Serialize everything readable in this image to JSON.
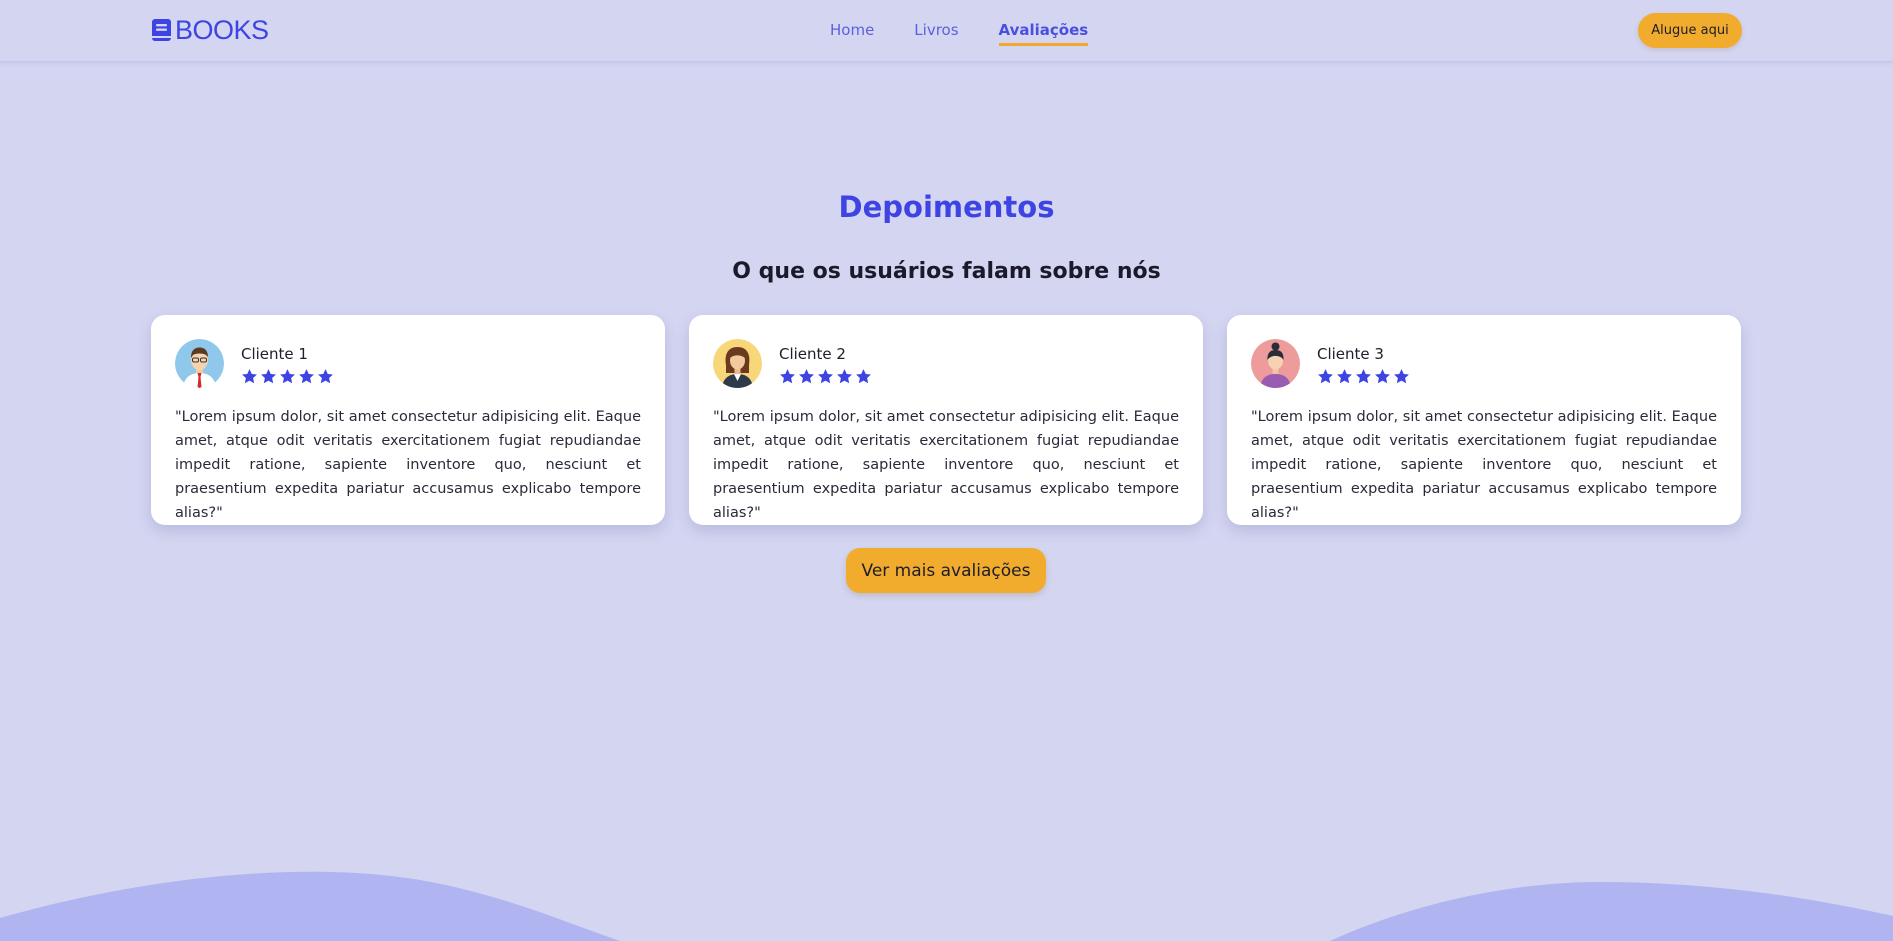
{
  "header": {
    "logo_text": "BOOKS",
    "nav": [
      {
        "label": "Home",
        "active": false
      },
      {
        "label": "Livros",
        "active": false
      },
      {
        "label": "Avaliações",
        "active": true
      }
    ],
    "cta_label": "Alugue aqui"
  },
  "section": {
    "title": "Depoimentos",
    "subtitle": "O que os usuários falam sobre nós"
  },
  "testimonials": [
    {
      "name": "Cliente 1",
      "rating": 5,
      "avatar_icon": "man-avatar-icon",
      "quote": "\"Lorem ipsum dolor, sit amet consectetur adipisicing elit. Eaque amet, atque odit veritatis exercitationem fugiat repudiandae impedit ratione, sapiente inventore quo, nesciunt et praesentium expedita pariatur accusamus explicabo tempore alias?\""
    },
    {
      "name": "Cliente 2",
      "rating": 5,
      "avatar_icon": "woman-avatar-icon",
      "quote": "\"Lorem ipsum dolor, sit amet consectetur adipisicing elit. Eaque amet, atque odit veritatis exercitationem fugiat repudiandae impedit ratione, sapiente inventore quo, nesciunt et praesentium expedita pariatur accusamus explicabo tempore alias?\""
    },
    {
      "name": "Cliente 3",
      "rating": 5,
      "avatar_icon": "woman-bun-avatar-icon",
      "quote": "\"Lorem ipsum dolor, sit amet consectetur adipisicing elit. Eaque amet, atque odit veritatis exercitationem fugiat repudiandae impedit ratione, sapiente inventore quo, nesciunt et praesentium expedita pariatur accusamus explicabo tempore alias?\""
    }
  ],
  "more_button_label": "Ver mais avaliações",
  "colors": {
    "background": "#d3d5f1",
    "brand": "#3d44e3",
    "accent": "#f2ac2d",
    "wave": "#b0b4f0"
  }
}
